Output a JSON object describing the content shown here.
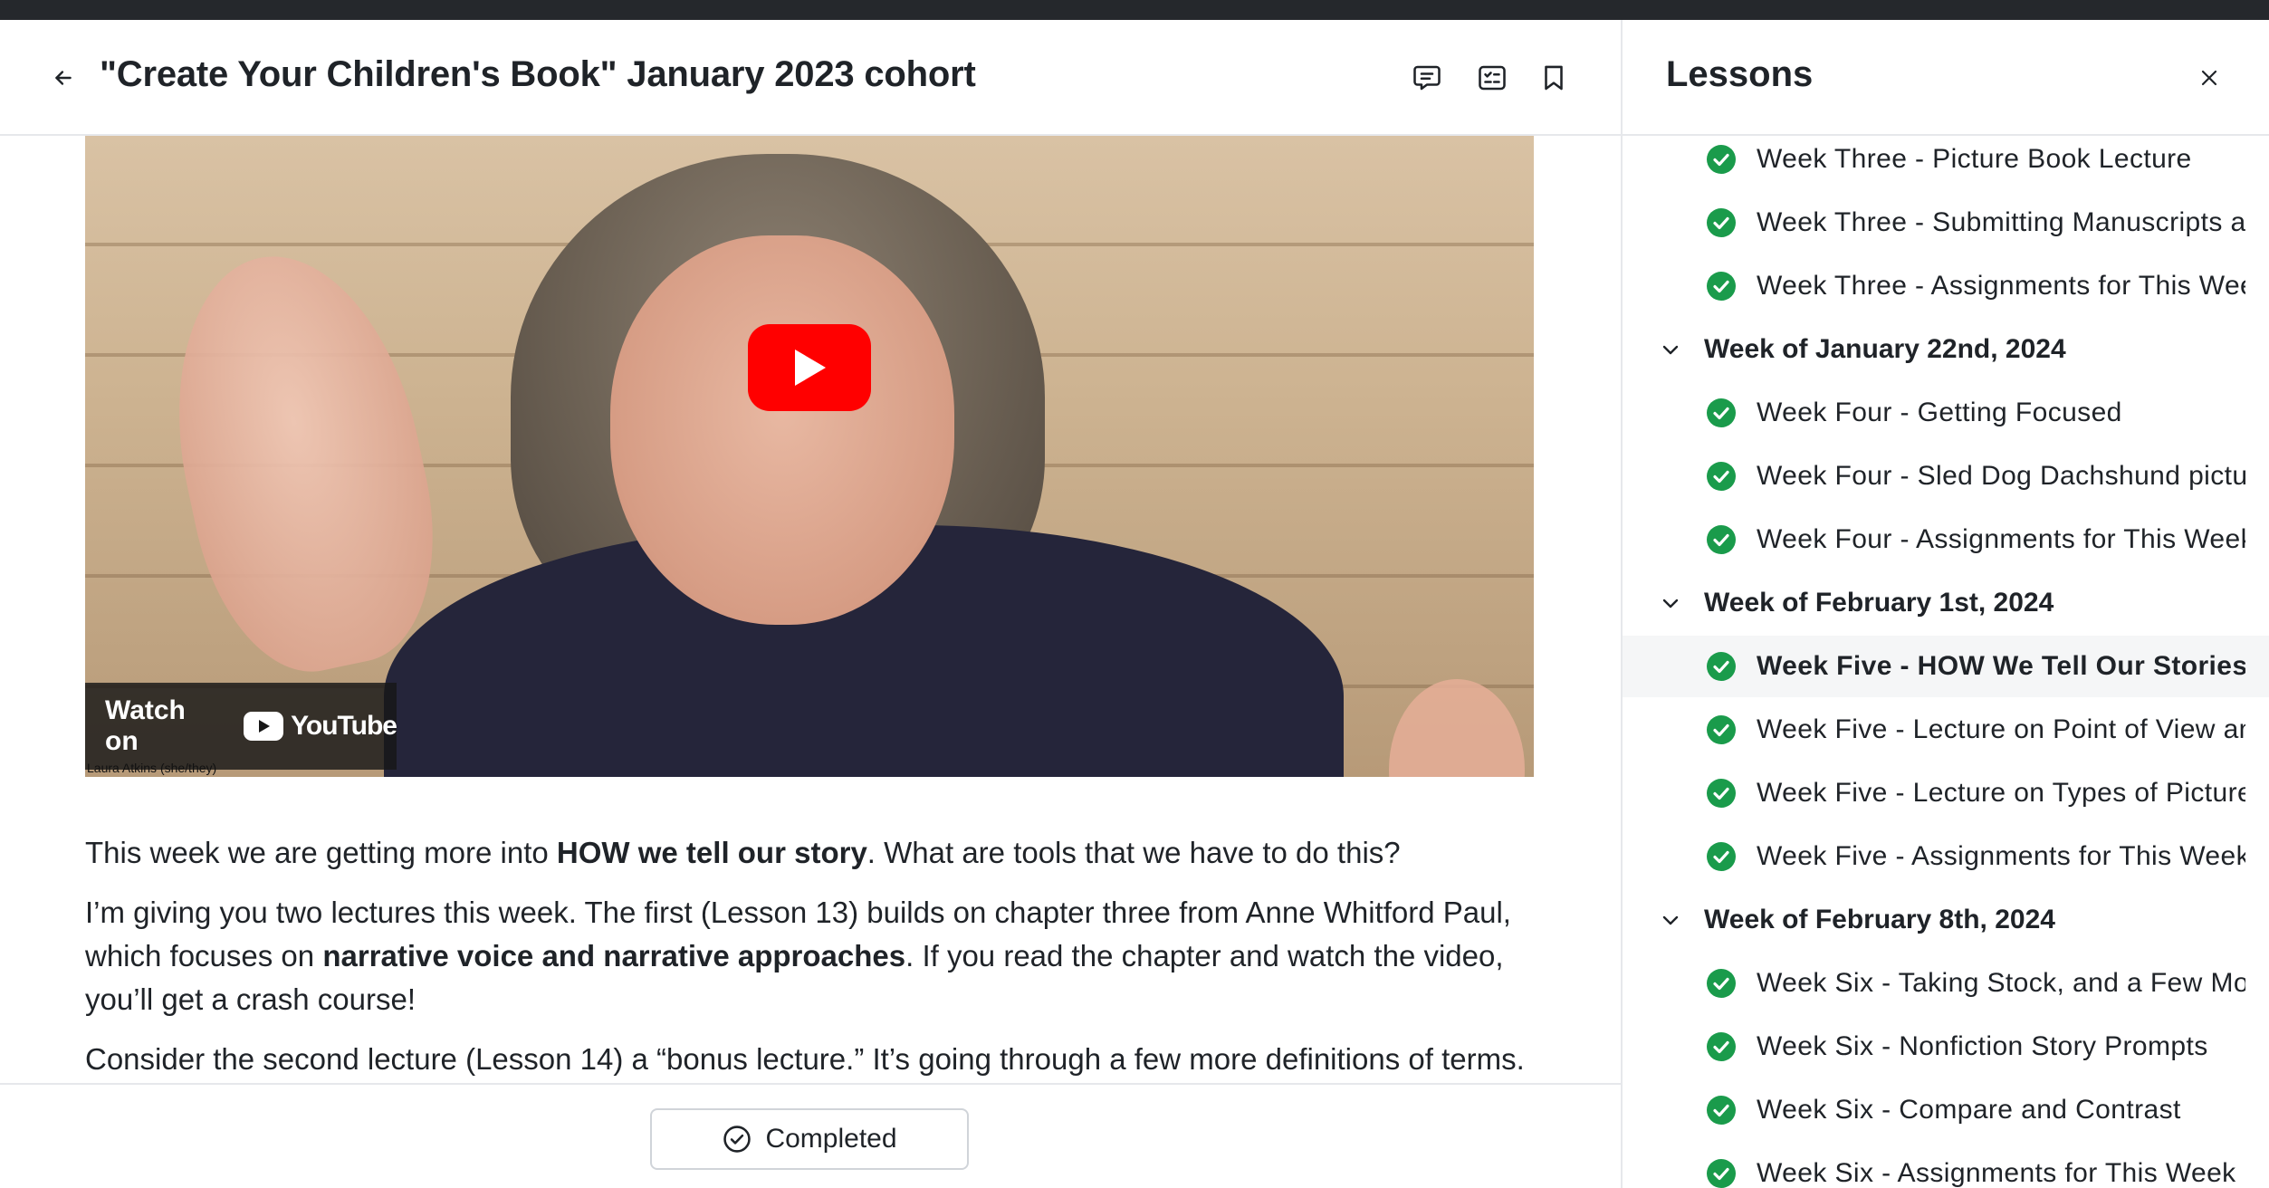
{
  "header": {
    "title": "\"Create Your Children's Book\" January 2023 cohort"
  },
  "video": {
    "watch_on_label": "Watch on",
    "youtube_word": "YouTube",
    "participant_name": "Laura Atkins (she/they)"
  },
  "article": {
    "p1_a": "This week we are getting more into ",
    "p1_bold": "HOW we tell our story",
    "p1_b": ". What are tools that we have to do this?",
    "p2_a": "I’m giving you two lectures this week. The first (Lesson 13) builds on chapter three from Anne Whitford Paul, which focuses on ",
    "p2_bold": "narrative voice and narrative approaches",
    "p2_b": ". If you read the chapter and watch the video, you’ll get a crash course!",
    "p3": "Consider the second lecture (Lesson 14) a “bonus lecture.” It’s going through a few more definitions of terms."
  },
  "bottom": {
    "completed_label": "Completed"
  },
  "sidebar": {
    "title": "Lessons",
    "items": [
      {
        "type": "lesson",
        "label": "Week Three - Picture Book Lecture",
        "completed": true
      },
      {
        "type": "lesson",
        "label": "Week Three - Submitting Manuscripts and Art",
        "completed": true
      },
      {
        "type": "lesson",
        "label": "Week Three - Assignments for This Week",
        "completed": true
      },
      {
        "type": "section",
        "label": "Week of January 22nd, 2024",
        "expanded": true
      },
      {
        "type": "lesson",
        "label": "Week Four - Getting Focused",
        "completed": true
      },
      {
        "type": "lesson",
        "label": "Week Four - Sled Dog Dachshund picture book",
        "completed": true
      },
      {
        "type": "lesson",
        "label": "Week Four - Assignments for This Week",
        "completed": true
      },
      {
        "type": "section",
        "label": "Week of February 1st, 2024",
        "expanded": true
      },
      {
        "type": "lesson",
        "label": "Week Five - HOW We Tell Our Stories",
        "completed": true,
        "active": true
      },
      {
        "type": "lesson",
        "label": "Week Five - Lecture on Point of View and Voice",
        "completed": true
      },
      {
        "type": "lesson",
        "label": "Week Five - Lecture on Types of Picture Books",
        "completed": true
      },
      {
        "type": "lesson",
        "label": "Week Five - Assignments for This Week",
        "completed": true
      },
      {
        "type": "section",
        "label": "Week of February 8th, 2024",
        "expanded": true
      },
      {
        "type": "lesson",
        "label": "Week Six - Taking Stock, and a Few More Tools",
        "completed": true
      },
      {
        "type": "lesson",
        "label": "Week Six - Nonfiction Story Prompts",
        "completed": true
      },
      {
        "type": "lesson",
        "label": "Week Six - Compare and Contrast",
        "completed": true
      },
      {
        "type": "lesson",
        "label": "Week Six - Assignments for This Week",
        "completed": true
      }
    ]
  },
  "colors": {
    "check_green": "#1a9b4b",
    "youtube_red": "#ff0000",
    "active_row": "#f5f6f7",
    "border": "#e6e8eb"
  }
}
